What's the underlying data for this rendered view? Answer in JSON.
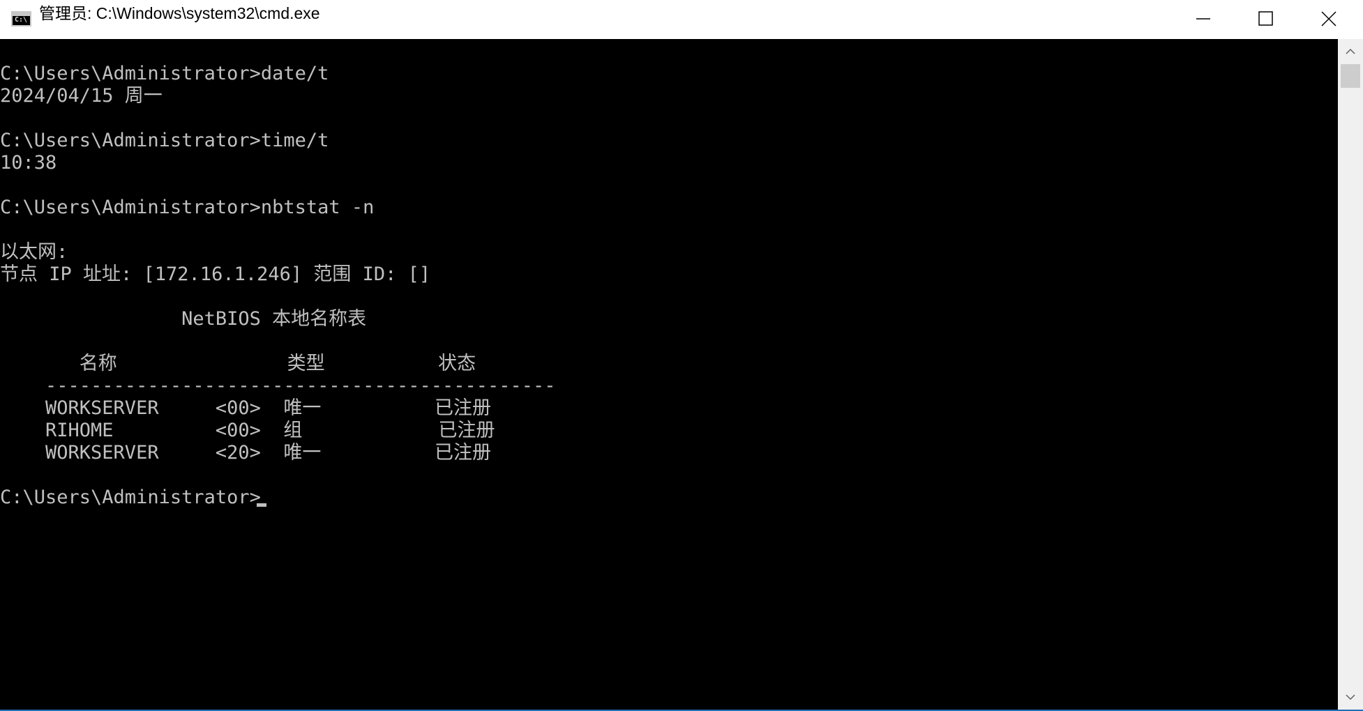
{
  "window": {
    "title": "管理员: C:\\Windows\\system32\\cmd.exe",
    "icon": "cmd-icon",
    "controls": {
      "minimize": "minimize-icon",
      "maximize": "maximize-icon",
      "close": "close-icon"
    }
  },
  "console": {
    "lines": [
      "C:\\Users\\Administrator>date/t",
      "2024/04/15 周一",
      "",
      "C:\\Users\\Administrator>time/t",
      "10:38",
      "",
      "C:\\Users\\Administrator>nbtstat -n",
      "",
      "以太网:",
      "节点 IP 址址: [172.16.1.246] 范围 ID: []",
      "",
      "                NetBIOS 本地名称表",
      "",
      "       名称               类型          状态",
      "    ---------------------------------------------",
      "    WORKSERVER     <00>  唯一          已注册",
      "    RIHOME         <00>  组            已注册",
      "    WORKSERVER     <20>  唯一          已注册",
      "",
      "C:\\Users\\Administrator>"
    ]
  },
  "colors": {
    "console_background": "#000000",
    "console_text": "#c0c0c0",
    "titlebar_background": "#ffffff"
  }
}
